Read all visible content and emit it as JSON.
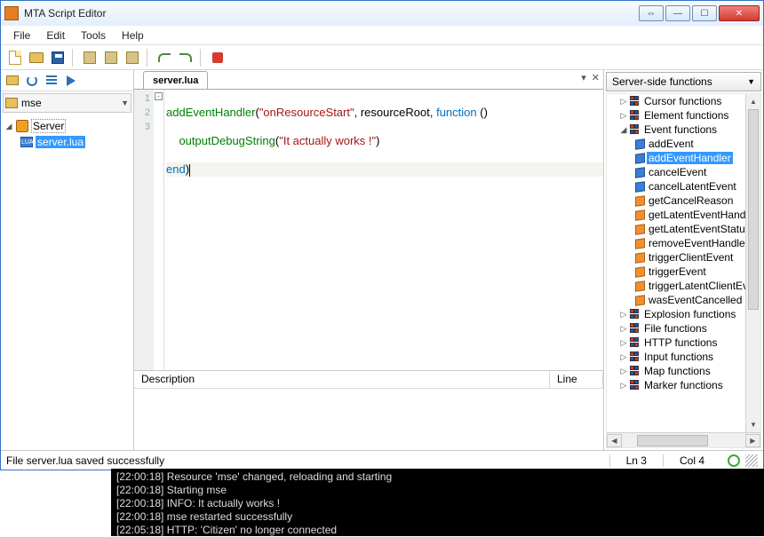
{
  "window": {
    "title": "MTA Script Editor"
  },
  "menu": {
    "file": "File",
    "edit": "Edit",
    "tools": "Tools",
    "help": "Help"
  },
  "project": {
    "name": "mse"
  },
  "tree": {
    "root": "Server",
    "file": "server.lua"
  },
  "tab": {
    "name": "server.lua"
  },
  "code": {
    "lines": [
      "1",
      "2",
      "3"
    ],
    "l1a": "addEventHandler",
    "l1b": "(",
    "l1c": "\"onResourceStart\"",
    "l1d": ", resourceRoot, ",
    "l1e": "function",
    "l1f": " ()",
    "l2a": "    ",
    "l2b": "outputDebugString",
    "l2c": "(",
    "l2d": "\"It actually works !\"",
    "l2e": ")",
    "l3a": "end",
    "l3b": ")"
  },
  "desc": {
    "description": "Description",
    "line": "Line"
  },
  "right": {
    "combo": "Server-side functions",
    "cats": {
      "cursor": "Cursor functions",
      "element": "Element functions",
      "event": "Event functions",
      "explosion": "Explosion functions",
      "file": "File functions",
      "http": "HTTP functions",
      "input": "Input functions",
      "map": "Map functions",
      "marker": "Marker functions"
    },
    "event_funcs": {
      "addEvent": "addEvent",
      "addEventHandler": "addEventHandler",
      "cancelEvent": "cancelEvent",
      "cancelLatentEvent": "cancelLatentEvent",
      "getCancelReason": "getCancelReason",
      "getLatentEventHandles": "getLatentEventHand",
      "getLatentEventStatus": "getLatentEventStatu",
      "removeEventHandler": "removeEventHandler",
      "triggerClientEvent": "triggerClientEvent",
      "triggerEvent": "triggerEvent",
      "triggerLatentClientEvent": "triggerLatentClientEv",
      "wasEventCancelled": "wasEventCancelled"
    }
  },
  "status": {
    "message": "File server.lua saved successfully",
    "ln": "Ln 3",
    "col": "Col 4"
  },
  "console": {
    "l1": "[22:00:18] Resource 'mse' changed, reloading and starting",
    "l2": "[22:00:18] Starting mse",
    "l3": "[22:00:18] INFO: It actually works !",
    "l4": "[22:00:18] mse restarted successfully",
    "l5": "[22:05:18] HTTP: 'Citizen' no longer connected"
  }
}
